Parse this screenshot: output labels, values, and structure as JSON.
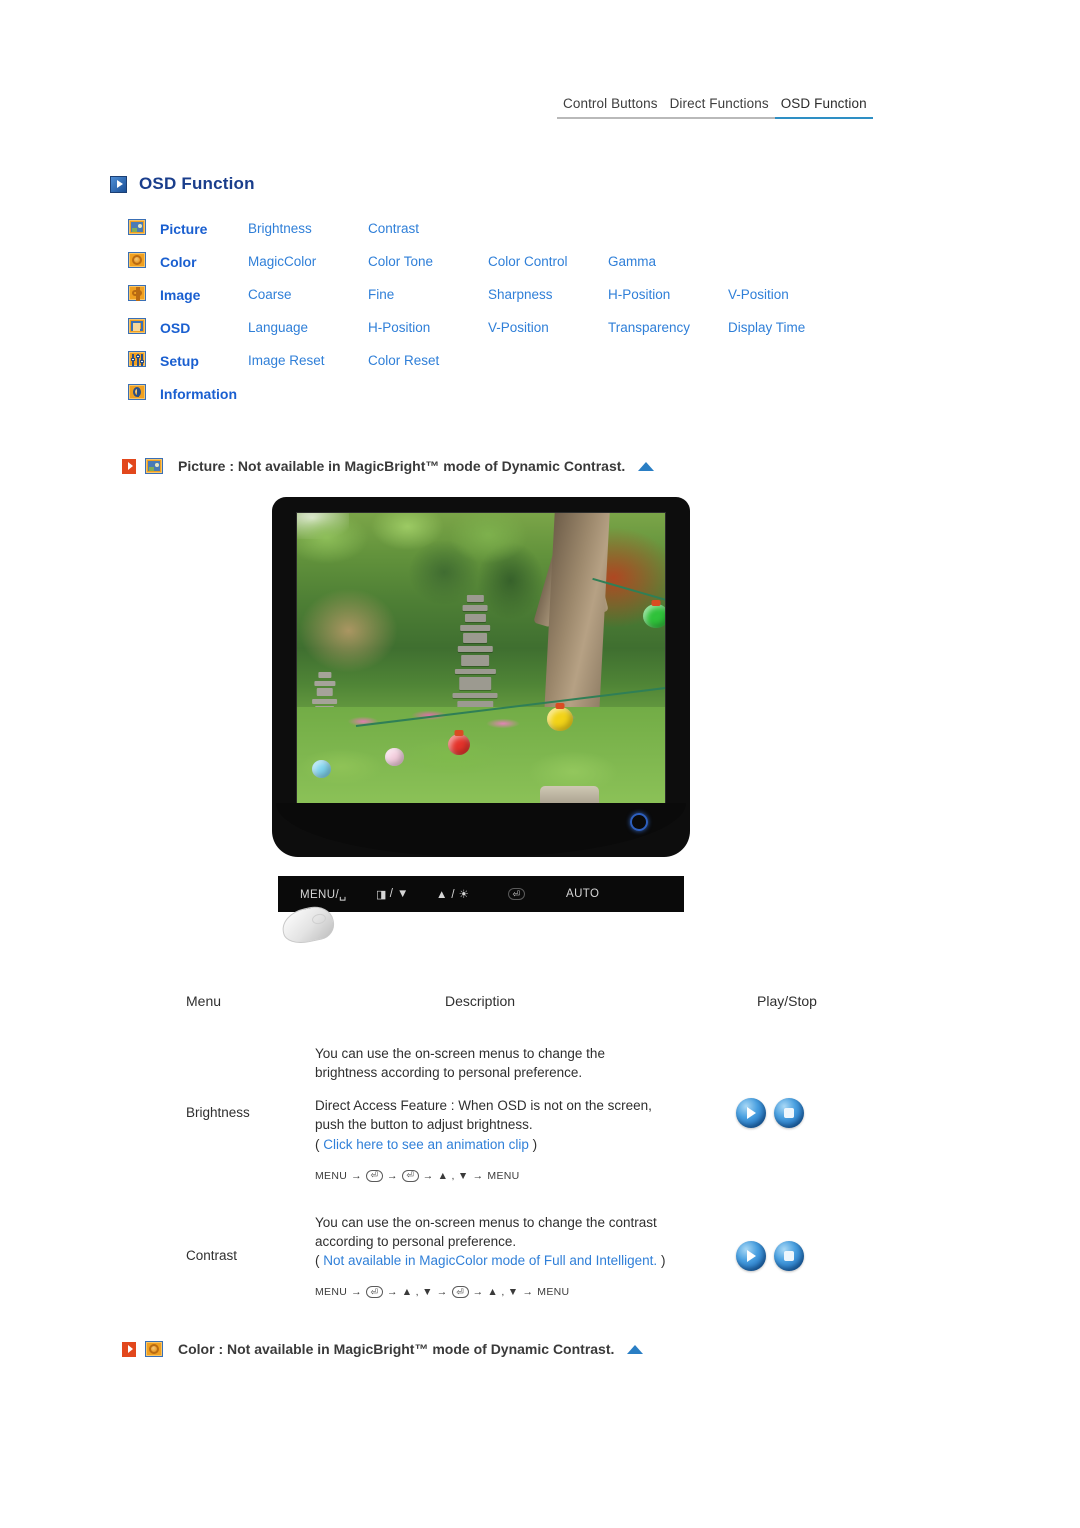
{
  "tabs": [
    {
      "label": "Control Buttons",
      "active": false
    },
    {
      "label": "Direct Functions",
      "active": false
    },
    {
      "label": "OSD Function",
      "active": true
    }
  ],
  "section": {
    "title": "OSD Function"
  },
  "menu_matrix": {
    "rows": [
      {
        "icon": "picture-icon",
        "category": "Picture",
        "items": [
          "Brightness",
          "Contrast",
          "",
          "",
          ""
        ]
      },
      {
        "icon": "color-icon",
        "category": "Color",
        "items": [
          "MagicColor",
          "Color Tone",
          "Color Control",
          "Gamma",
          ""
        ]
      },
      {
        "icon": "image-icon",
        "category": "Image",
        "items": [
          "Coarse",
          "Fine",
          "Sharpness",
          "H-Position",
          "V-Position"
        ]
      },
      {
        "icon": "osd-icon",
        "category": "OSD",
        "items": [
          "Language",
          "H-Position",
          "V-Position",
          "Transparency",
          "Display Time"
        ]
      },
      {
        "icon": "setup-icon",
        "category": "Setup",
        "items": [
          "Image Reset",
          "Color Reset",
          "",
          "",
          ""
        ]
      },
      {
        "icon": "information-icon",
        "category": "Information",
        "items": [
          "",
          "",
          "",
          "",
          ""
        ]
      }
    ]
  },
  "notes": {
    "picture": "Picture : Not available in MagicBright™ mode of Dynamic Contrast.",
    "color": "Color : Not available in MagicBright™ mode of Dynamic Contrast."
  },
  "monitor": {
    "control_buttons": [
      {
        "label": "MENU/␣",
        "glyph": ""
      },
      {
        "label": "/ ▼",
        "glyph": "◨"
      },
      {
        "label": "▲ / ☀",
        "glyph": ""
      },
      {
        "label": "⏎",
        "glyph": ""
      },
      {
        "label": "AUTO",
        "glyph": ""
      }
    ],
    "power_indicator": "power-ring"
  },
  "desc_table": {
    "headers": {
      "menu": "Menu",
      "description": "Description",
      "play_stop": "Play/Stop"
    },
    "rows": [
      {
        "menu": "Brightness",
        "lines": [
          "You can use the on-screen menus to change the",
          "brightness according to personal preference."
        ],
        "lines2": [
          "Direct Access Feature : When OSD is not on the screen,",
          "push the button to adjust brightness."
        ],
        "link_prefix": "( ",
        "link": "Click here to see an animation clip",
        "link_suffix": " )",
        "path": [
          "MENU",
          "→",
          "ENTER",
          "→",
          "ENTER",
          "→",
          "▲ , ▼",
          "→",
          "MENU"
        ]
      },
      {
        "menu": "Contrast",
        "lines": [
          "You can use the on-screen menus to change the contrast",
          "according to personal preference."
        ],
        "lines2": [],
        "link_prefix": "( ",
        "link": "Not available in MagicColor mode of Full and Intelligent.",
        "link_suffix": " )",
        "path": [
          "MENU",
          "→",
          "ENTER",
          "→",
          "▲ , ▼",
          "→",
          "ENTER",
          "→",
          "▲ , ▼",
          "→",
          "MENU"
        ]
      }
    ]
  },
  "colors": {
    "accent_blue": "#2f7fd8",
    "heading_blue": "#1a3e8c",
    "category_blue": "#1a5fd0",
    "tab_underline": "#2e8fc4",
    "marker_red": "#e2471c",
    "icon_orange": "#f0a020"
  }
}
